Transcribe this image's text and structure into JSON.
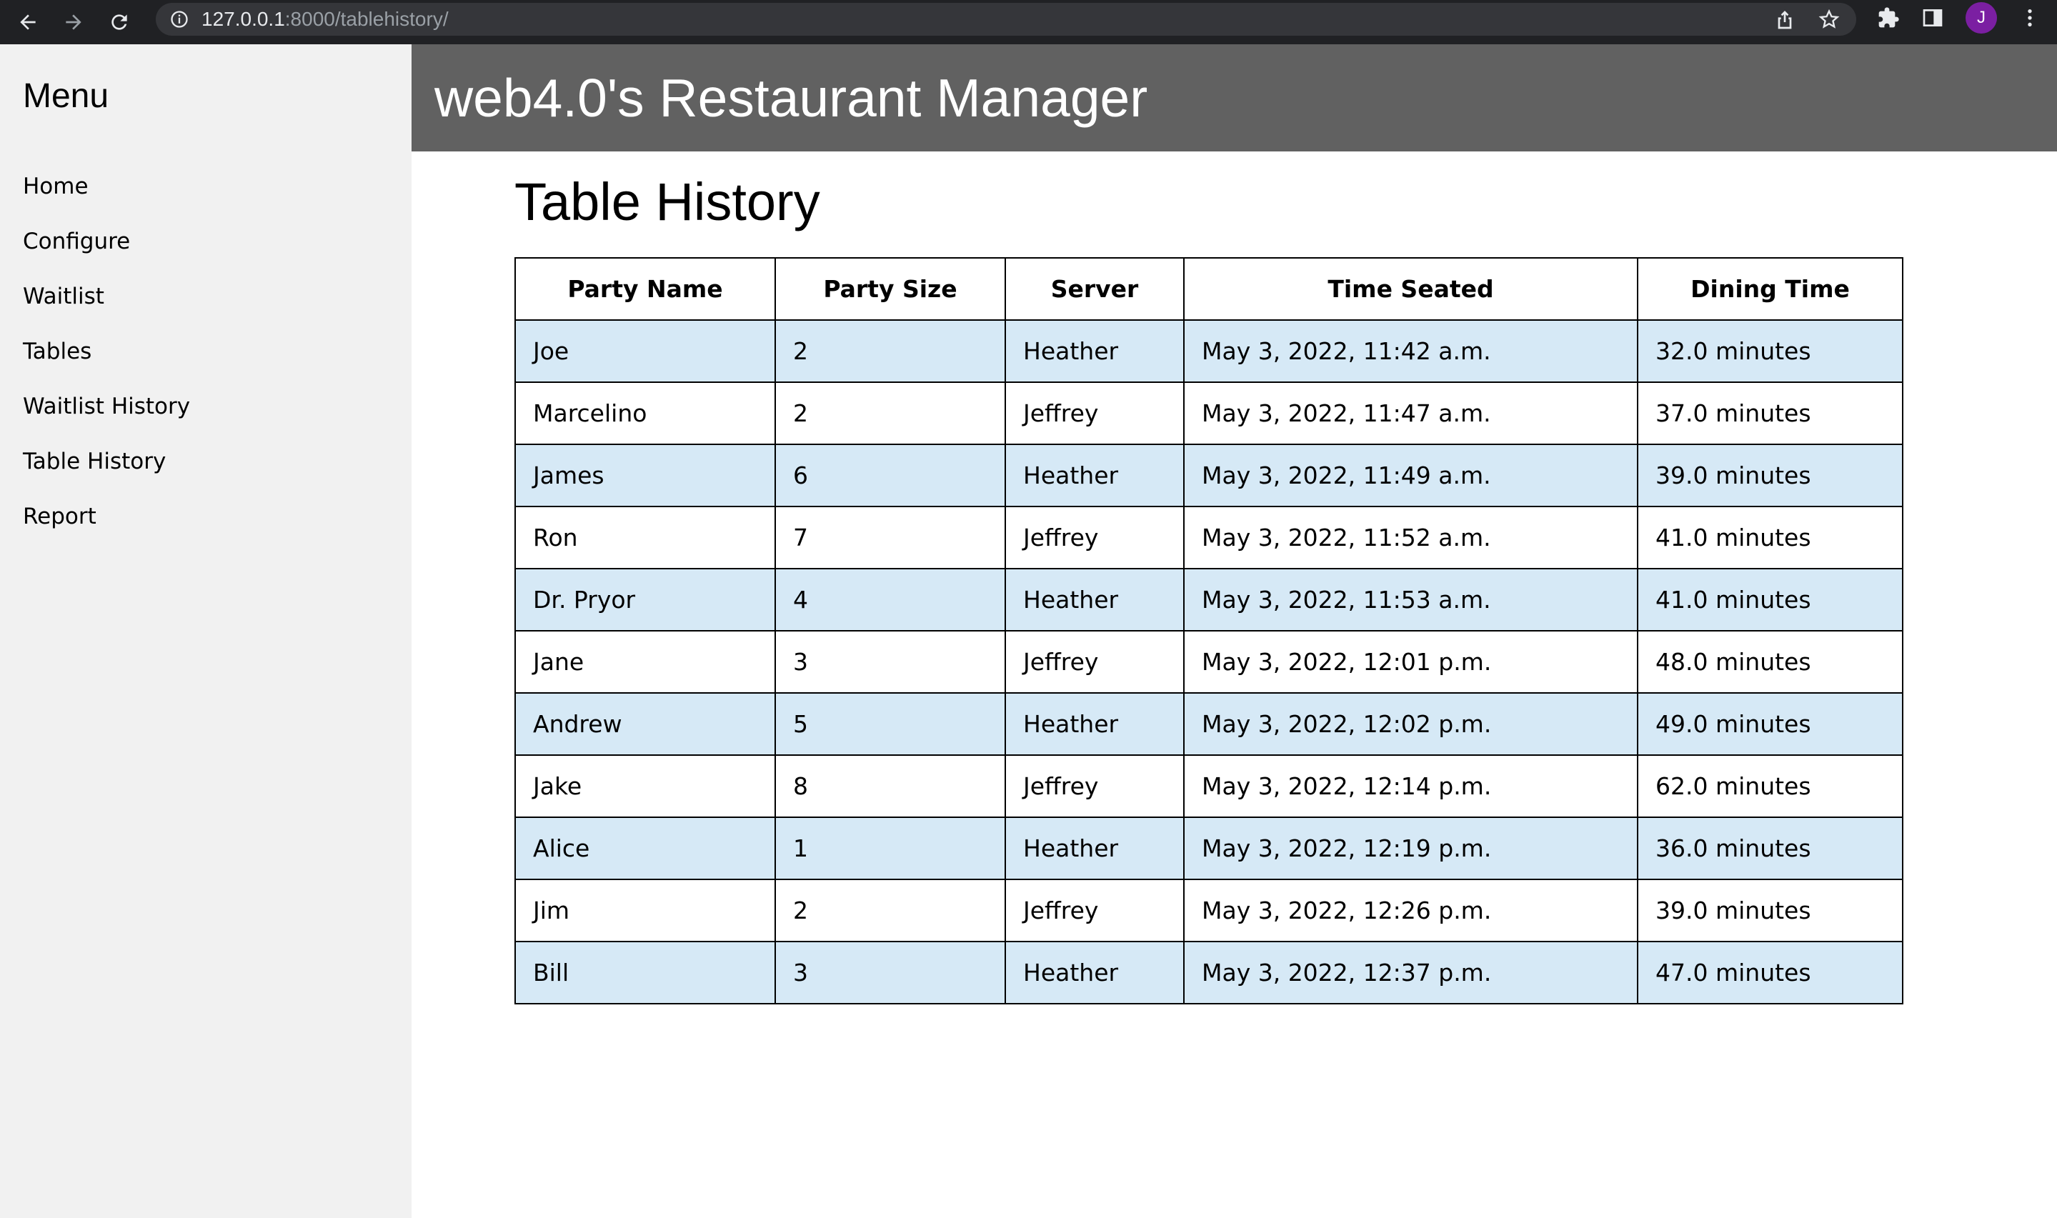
{
  "browser": {
    "url_host": "127.0.0.1",
    "url_rest": ":8000/tablehistory/",
    "profile_initial": "J"
  },
  "sidebar": {
    "title": "Menu",
    "items": [
      {
        "label": "Home"
      },
      {
        "label": "Configure"
      },
      {
        "label": "Waitlist"
      },
      {
        "label": "Tables"
      },
      {
        "label": "Waitlist History"
      },
      {
        "label": "Table History"
      },
      {
        "label": "Report"
      }
    ]
  },
  "header": {
    "title": "web4.0's Restaurant Manager"
  },
  "main": {
    "title": "Table History",
    "table": {
      "columns": [
        "Party Name",
        "Party Size",
        "Server",
        "Time Seated",
        "Dining Time"
      ],
      "rows": [
        [
          "Joe",
          "2",
          "Heather",
          "May 3, 2022, 11:42 a.m.",
          "32.0 minutes"
        ],
        [
          "Marcelino",
          "2",
          "Jeffrey",
          "May 3, 2022, 11:47 a.m.",
          "37.0 minutes"
        ],
        [
          "James",
          "6",
          "Heather",
          "May 3, 2022, 11:49 a.m.",
          "39.0 minutes"
        ],
        [
          "Ron",
          "7",
          "Jeffrey",
          "May 3, 2022, 11:52 a.m.",
          "41.0 minutes"
        ],
        [
          "Dr. Pryor",
          "4",
          "Heather",
          "May 3, 2022, 11:53 a.m.",
          "41.0 minutes"
        ],
        [
          "Jane",
          "3",
          "Jeffrey",
          "May 3, 2022, 12:01 p.m.",
          "48.0 minutes"
        ],
        [
          "Andrew",
          "5",
          "Heather",
          "May 3, 2022, 12:02 p.m.",
          "49.0 minutes"
        ],
        [
          "Jake",
          "8",
          "Jeffrey",
          "May 3, 2022, 12:14 p.m.",
          "62.0 minutes"
        ],
        [
          "Alice",
          "1",
          "Heather",
          "May 3, 2022, 12:19 p.m.",
          "36.0 minutes"
        ],
        [
          "Jim",
          "2",
          "Jeffrey",
          "May 3, 2022, 12:26 p.m.",
          "39.0 minutes"
        ],
        [
          "Bill",
          "3",
          "Heather",
          "May 3, 2022, 12:37 p.m.",
          "47.0 minutes"
        ]
      ]
    }
  },
  "colors": {
    "chrome_bg": "#202124",
    "omnibox_bg": "#35363a",
    "sidebar_bg": "#f1f1f1",
    "header_bg": "#616161",
    "row_alt_bg": "#d6e9f6",
    "profile_bg": "#7b1fa2"
  },
  "icons": [
    "back-arrow-icon",
    "forward-arrow-icon",
    "reload-icon",
    "info-icon",
    "share-icon",
    "star-icon",
    "extensions-icon",
    "side-panel-icon",
    "kebab-menu-icon"
  ]
}
